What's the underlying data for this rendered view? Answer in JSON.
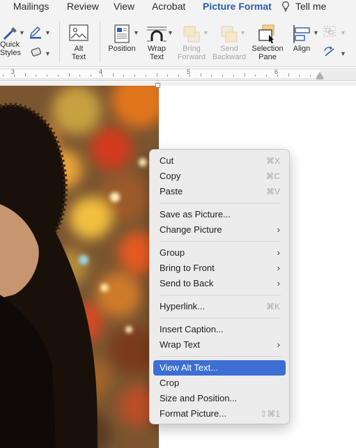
{
  "ribbon_tabs": [
    {
      "label": "Mailings",
      "active": false
    },
    {
      "label": "Review",
      "active": false
    },
    {
      "label": "View",
      "active": false
    },
    {
      "label": "Acrobat",
      "active": false
    },
    {
      "label": "Picture Format",
      "active": true
    },
    {
      "label": "Tell me",
      "active": false
    }
  ],
  "ribbon": {
    "quick_styles_label": "Quick\nStyles",
    "alt_text_label": "Alt\nText",
    "position_label": "Position",
    "wrap_text_label": "Wrap\nText",
    "bring_forward_label": "Bring\nForward",
    "send_backward_label": "Send\nBackward",
    "selection_pane_label": "Selection\nPane",
    "align_label": "Align"
  },
  "ruler": {
    "numbers": [
      "3",
      "4",
      "5",
      "6"
    ]
  },
  "context_menu": {
    "items": [
      {
        "label": "Cut",
        "shortcut": "⌘X"
      },
      {
        "label": "Copy",
        "shortcut": "⌘C"
      },
      {
        "label": "Paste",
        "shortcut": "⌘V"
      },
      {
        "label": "Save as Picture..."
      },
      {
        "label": "Change Picture",
        "submenu": true
      },
      {
        "label": "Group",
        "submenu": true
      },
      {
        "label": "Bring to Front",
        "submenu": true
      },
      {
        "label": "Send to Back",
        "submenu": true
      },
      {
        "label": "Hyperlink...",
        "shortcut": "⌘K"
      },
      {
        "label": "Insert Caption..."
      },
      {
        "label": "Wrap Text",
        "submenu": true
      },
      {
        "label": "View Alt Text...",
        "highlighted": true
      },
      {
        "label": "Crop"
      },
      {
        "label": "Size and Position..."
      },
      {
        "label": "Format Picture...",
        "shortcut": "⇧⌘1"
      }
    ]
  },
  "colors": {
    "accent": "#2a5db0",
    "menu_highlight": "#3d6ed1",
    "menu_background": "#ececec",
    "ribbon_background": "#f3f3f3"
  }
}
